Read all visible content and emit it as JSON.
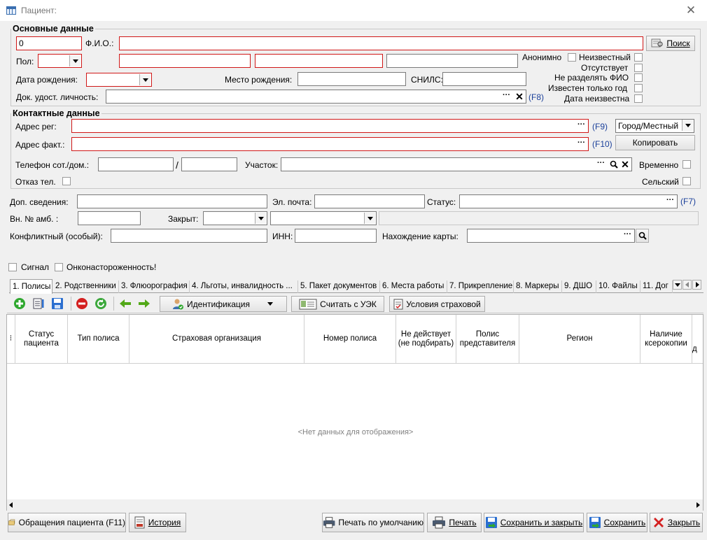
{
  "window": {
    "title": "Пациент:",
    "close_label": "✕"
  },
  "main": {
    "title": "Основные данные",
    "id_value": "0",
    "fio_label": "Ф.И.О.:",
    "search_label": "Поиск",
    "sex_label": "Пол:",
    "birthdate_label": "Дата рождения:",
    "birthplace_label": "Место рождения:",
    "snils_label": "СНИЛС:",
    "doc_label": "Док. удост. личность:",
    "doc_hotkey": "(F8)",
    "anonymous_label": "Анонимно",
    "unknown_label": "Неизвестный",
    "absent_label": "Отсутствует",
    "no_split_label": "Не разделять ФИО",
    "year_only_label": "Известен только год",
    "date_unknown_label": "Дата неизвестна"
  },
  "contact": {
    "title": "Контактные данные",
    "addr_reg_label": "Адрес рег:",
    "addr_reg_hotkey": "(F9)",
    "city_value": "Город/Местный",
    "addr_fact_label": "Адрес факт.:",
    "addr_fact_hotkey": "(F10)",
    "copy_label": "Копировать",
    "phone_label": "Телефон сот./дом.:",
    "phone_sep": "/",
    "district_label": "Участок:",
    "temp_label": "Временно",
    "phone_refuse_label": "Отказ тел.",
    "rural_label": "Сельский"
  },
  "extra": {
    "dop_label": "Доп. сведения:",
    "email_label": "Эл. почта:",
    "status_label": "Статус:",
    "status_hotkey": "(F7)",
    "amb_label": "Вн. № амб. :",
    "closed_label": "Закрыт:",
    "conflict_label": "Конфликтный (особый):",
    "inn_label": "ИНН:",
    "card_label": "Нахождение карты:",
    "signal_label": "Сигнал",
    "onco_label": "Онконастороженность!"
  },
  "tabs": [
    "1. Полисы",
    "2. Родственники",
    "3. Флюорография",
    "4. Льготы, инвалидность ...",
    "5. Пакет документов",
    "6. Места работы",
    "7. Прикрепление",
    "8. Маркеры",
    "9. ДШО",
    "10. Файлы",
    "11. Дог"
  ],
  "toolbar": {
    "ident_label": "Идентификация",
    "uek_label": "Считать с УЭК",
    "ins_label": "Условия страховой"
  },
  "grid": {
    "columns": [
      "Статус пациента",
      "Тип полиса",
      "Страховая организация",
      "Номер полиса",
      "Не действует (не подбирать)",
      "Полис представителя",
      "Регион",
      "Наличие ксерокопии",
      "д"
    ],
    "empty": "<Нет данных для отображения>"
  },
  "bottom": {
    "visits_label": "Обращения пациента (F11)",
    "history_label": "История",
    "print_default_label": "Печать по умолчанию",
    "print_label": "Печать",
    "save_close_label": "Сохранить и закрыть",
    "save_label": "Сохранить",
    "close_label": "Закрыть"
  },
  "colors": {
    "required_border": "#d01818",
    "hotkey": "#1a3f9a",
    "add": "#2fa82f",
    "delete": "#d42020",
    "nav_arrows": "#52a818"
  },
  "icons": [
    "app-window-icon",
    "search-doc-icon",
    "add-icon",
    "edit-list-icon",
    "save-icon",
    "delete-icon",
    "refresh-icon",
    "arrow-left-icon",
    "arrow-right-icon",
    "user-check-icon",
    "id-card-icon",
    "insurance-doc-icon",
    "visits-icon",
    "history-icon",
    "printer-icon",
    "save-close-icon",
    "close-red-icon"
  ]
}
